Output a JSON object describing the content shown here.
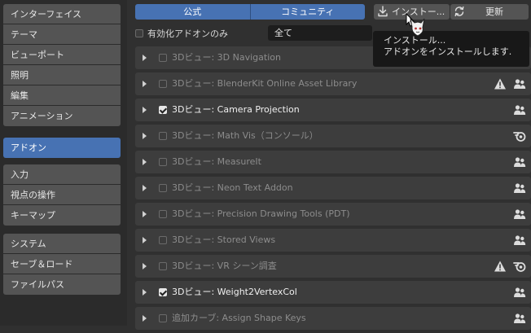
{
  "sidebar": {
    "group1": [
      {
        "label": "インターフェイス"
      },
      {
        "label": "テーマ"
      },
      {
        "label": "ビューポート"
      },
      {
        "label": "照明"
      },
      {
        "label": "編集"
      },
      {
        "label": "アニメーション"
      }
    ],
    "group2": [
      {
        "label": "アドオン",
        "active": true
      }
    ],
    "group3": [
      {
        "label": "入力"
      },
      {
        "label": "視点の操作"
      },
      {
        "label": "キーマップ"
      }
    ],
    "group4": [
      {
        "label": "システム"
      },
      {
        "label": "セーブ＆ロード"
      },
      {
        "label": "ファイルパス"
      }
    ]
  },
  "header": {
    "tabs": [
      "公式",
      "コミュニティ"
    ],
    "install_label": "インストー...",
    "refresh_label": "更新"
  },
  "filter": {
    "enabled_only_label": "有効化アドオンのみ",
    "category_value": "全て"
  },
  "tooltip": {
    "line1": "インストール...",
    "line2": "アドオンをインストールします."
  },
  "addons": [
    {
      "name": "3Dビュー: 3D Navigation",
      "enabled": false,
      "icons": []
    },
    {
      "name": "3Dビュー: BlenderKit Online Asset Library",
      "enabled": false,
      "icons": [
        "warning-icon",
        "community-icon"
      ]
    },
    {
      "name": "3Dビュー: Camera Projection",
      "enabled": true,
      "icons": [
        "community-icon"
      ]
    },
    {
      "name": "3Dビュー: Math Vis（コンソール）",
      "enabled": false,
      "icons": [
        "blender-icon"
      ]
    },
    {
      "name": "3Dビュー: MeasureIt",
      "enabled": false,
      "icons": [
        "community-icon"
      ]
    },
    {
      "name": "3Dビュー: Neon Text Addon",
      "enabled": false,
      "icons": [
        "community-icon"
      ]
    },
    {
      "name": "3Dビュー: Precision Drawing Tools (PDT)",
      "enabled": false,
      "icons": [
        "community-icon"
      ]
    },
    {
      "name": "3Dビュー: Stored Views",
      "enabled": false,
      "icons": [
        "community-icon"
      ]
    },
    {
      "name": "3Dビュー: VR シーン調査",
      "enabled": false,
      "icons": [
        "warning-icon",
        "blender-icon"
      ]
    },
    {
      "name": "3Dビュー: Weight2VertexCol",
      "enabled": true,
      "icons": [
        "community-icon"
      ]
    },
    {
      "name": "追加カーブ: Assign Shape Keys",
      "enabled": false,
      "icons": [
        "community-icon"
      ]
    }
  ],
  "colors": {
    "accent": "#4772b3",
    "panel": "#3d3d3d",
    "background": "#303030",
    "sidebar": "#2b2b2b"
  }
}
